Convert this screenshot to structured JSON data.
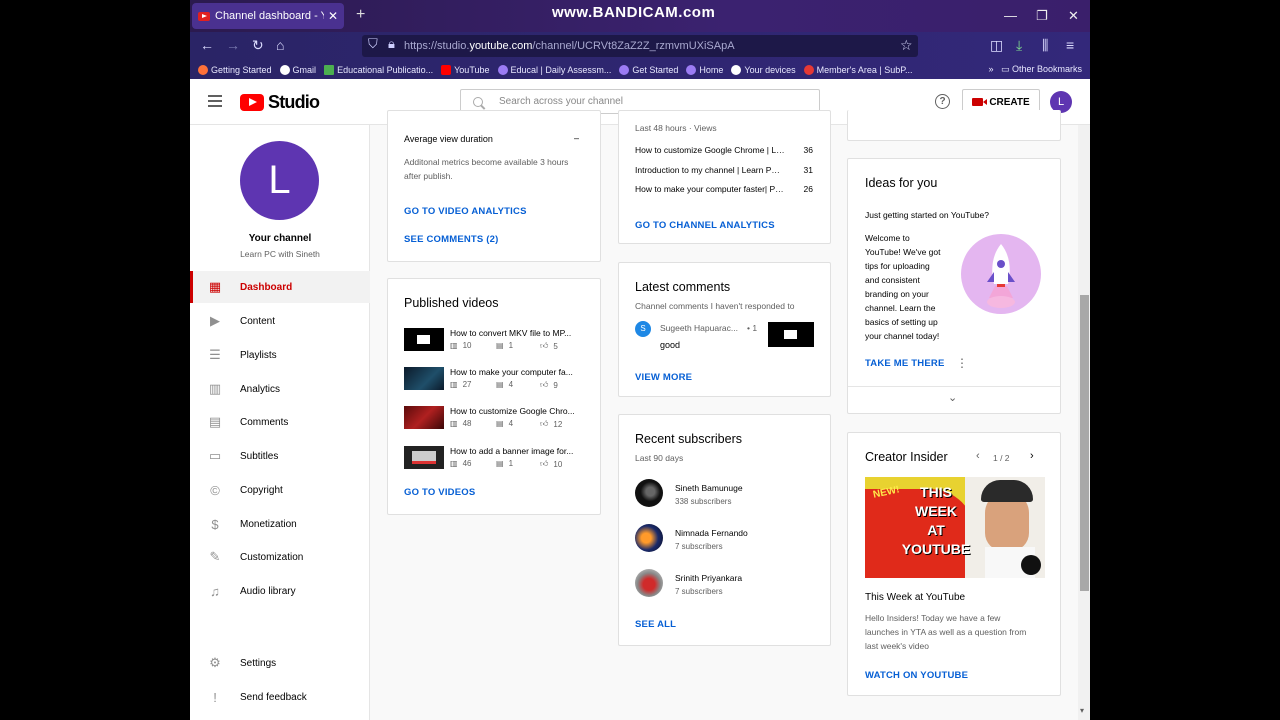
{
  "browser": {
    "tab_title": "Channel dashboard - YouTube",
    "watermark": "www.BANDICAM.com",
    "url_prefix": "https://studio.",
    "url_domain": "youtube.com",
    "url_path": "/channel/UCRVt8ZaZ2Z_rzmvmUXiSApA",
    "bookmarks": [
      {
        "label": "Getting Started",
        "color": "#ff7139"
      },
      {
        "label": "Gmail",
        "color": "#ffffff"
      },
      {
        "label": "Educational Publicatio...",
        "color": "#4caf50"
      },
      {
        "label": "YouTube",
        "color": "#ff0000"
      },
      {
        "label": "Educal | Daily Assessm...",
        "color": "#9c7cf4"
      },
      {
        "label": "Get Started",
        "color": "#9c7cf4"
      },
      {
        "label": "Home",
        "color": "#9c7cf4"
      },
      {
        "label": "Your devices",
        "color": "#ffffff"
      },
      {
        "label": "Member's Area | SubP...",
        "color": "#e53935"
      }
    ],
    "other_bookmarks": "Other Bookmarks"
  },
  "header": {
    "logo_text": "Studio",
    "search_placeholder": "Search across your channel",
    "create_label": "CREATE",
    "avatar_letter": "L"
  },
  "sidebar": {
    "avatar_letter": "L",
    "channel_label": "Your channel",
    "channel_name": "Learn PC with Sineth",
    "items": [
      {
        "label": "Dashboard",
        "icon": "dashboard-icon"
      },
      {
        "label": "Content",
        "icon": "content-icon"
      },
      {
        "label": "Playlists",
        "icon": "playlists-icon"
      },
      {
        "label": "Analytics",
        "icon": "analytics-icon"
      },
      {
        "label": "Comments",
        "icon": "comments-icon"
      },
      {
        "label": "Subtitles",
        "icon": "subtitles-icon"
      },
      {
        "label": "Copyright",
        "icon": "copyright-icon"
      },
      {
        "label": "Monetization",
        "icon": "monetization-icon"
      },
      {
        "label": "Customization",
        "icon": "customization-icon"
      },
      {
        "label": "Audio library",
        "icon": "audio-library-icon"
      }
    ],
    "settings_label": "Settings",
    "feedback_label": "Send feedback"
  },
  "latest_video": {
    "avg_view_label": "Average view duration",
    "avg_view_value": "–",
    "metrics_note_1": "Additonal metrics become available 3 hours",
    "metrics_note_2": "after publish.",
    "analytics_link": "GO TO VIDEO ANALYTICS",
    "comments_link": "SEE COMMENTS (2)"
  },
  "published": {
    "title": "Published videos",
    "videos": [
      {
        "title": "How to convert MKV file to MP...",
        "views": "10",
        "comments": "1",
        "likes": "5"
      },
      {
        "title": "How to make your computer fa...",
        "views": "27",
        "comments": "4",
        "likes": "9"
      },
      {
        "title": "How to customize Google Chro...",
        "views": "48",
        "comments": "4",
        "likes": "12"
      },
      {
        "title": "How to add a banner image for...",
        "views": "46",
        "comments": "1",
        "likes": "10"
      }
    ],
    "link": "GO TO VIDEOS"
  },
  "analytics": {
    "subtitle": "Last 48 hours · Views",
    "top": [
      {
        "title": "How to customize Google Chrome | Le...",
        "views": "36"
      },
      {
        "title": "Introduction to my channel | Learn PC ...",
        "views": "31"
      },
      {
        "title": "How to make your computer faster| Pa...",
        "views": "26"
      }
    ],
    "link": "GO TO CHANNEL ANALYTICS"
  },
  "comments": {
    "title": "Latest comments",
    "subtitle": "Channel comments I haven't responded to",
    "author_initial": "S",
    "author": "Sugeeth Hapuarac...",
    "time": "• 1",
    "text": "good",
    "link": "VIEW MORE"
  },
  "subscribers": {
    "title": "Recent subscribers",
    "subtitle": "Last 90 days",
    "list": [
      {
        "name": "Sineth Bamunuge",
        "count": "338 subscribers"
      },
      {
        "name": "Nimnada Fernando",
        "count": "7 subscribers"
      },
      {
        "name": "Srinith Priyankara",
        "count": "7 subscribers"
      }
    ],
    "link": "SEE ALL"
  },
  "ideas": {
    "title": "Ideas for you",
    "heading": "Just getting started on YouTube?",
    "body": [
      "Welcome to",
      "YouTube! We've got",
      "tips for uploading",
      "and consistent",
      "branding on your",
      "channel. Learn the",
      "basics of setting up",
      "your channel today!"
    ],
    "link": "TAKE ME THERE"
  },
  "insider": {
    "title": "Creator Insider",
    "pager": "1 / 2",
    "thumb_badge": "NEW!",
    "thumb_lines": [
      "THIS",
      "WEEK",
      "AT",
      "YOUTUBE"
    ],
    "video_title": "This Week at YouTube",
    "desc": [
      "Hello Insiders! Today we have a few",
      "launches in YTA as well as a question from",
      "last week's video"
    ],
    "link": "WATCH ON YOUTUBE"
  }
}
